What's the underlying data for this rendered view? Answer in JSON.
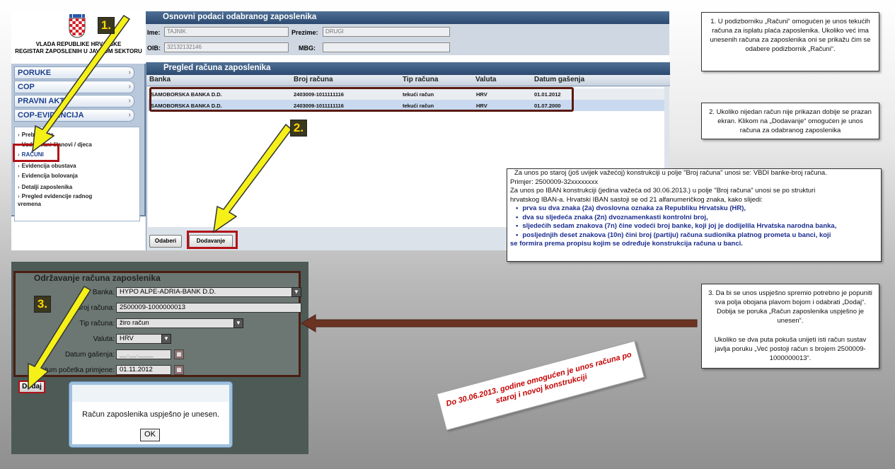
{
  "app": {
    "logo_line1": "VLADA REPUBLIKE HRVATSKE",
    "logo_line2": "REGISTAR ZAPOSLENIH U JAVNOM SEKTORU"
  },
  "sidebar": {
    "menu": [
      "PORUKE",
      "COP",
      "PRAVNI AKTI",
      "COP-EVIDENCIJA"
    ],
    "submenu": [
      "Prebivalište",
      "Uzdržavani članovi / djeca",
      "RAČUNI",
      "Evidencija obustava",
      "Evidencija bolovanja",
      "Detalji zaposlenika",
      "Pregled evidencije radnog vremena"
    ]
  },
  "employee_info": {
    "title": "Osnovni podaci odabranog zaposlenika",
    "ime_label": "Ime:",
    "ime_value": "TAJNIK",
    "prezime_label": "Prezime:",
    "prezime_value": "DRUGI",
    "oib_label": "OIB:",
    "oib_value": "32132132146",
    "mbg_label": "MBG:",
    "mbg_value": ""
  },
  "accounts": {
    "title": "Pregled računa zaposlenika",
    "columns": [
      "Banka",
      "Broj računa",
      "Tip računa",
      "Valuta",
      "Datum gašenja"
    ],
    "rows": [
      [
        "SAMOBORSKA BANKA D.D.",
        "2403009-1011111116",
        "tekući račun",
        "HRV",
        "01.01.2012"
      ],
      [
        "SAMOBORSKA BANKA D.D.",
        "2403009-1011111116",
        "tekući račun",
        "HRV",
        "01.07.2000"
      ]
    ],
    "btn_select": "Odaberi",
    "btn_add": "Dodavanje"
  },
  "maintenance": {
    "title": "Održavanje računa zaposlenika",
    "banka_label": "Banka:",
    "banka_value": "HYPO ALPE-ADRIA-BANK D.D.",
    "broj_label": "Broj računa:",
    "broj_value": "2500009-1000000013",
    "tip_label": "Tip računa:",
    "tip_value": "žiro račun",
    "valuta_label": "Valuta:",
    "valuta_value": "HRV",
    "gasenje_label": "Datum gašenja:",
    "gasenje_value": "__.__.____",
    "pocetak_label": "Datum početka primjene:",
    "pocetak_value": "01.11.2012",
    "btn_add": "Dodaj"
  },
  "dialog": {
    "message": "Račun zaposlenika uspješno je unesen.",
    "ok": "OK"
  },
  "badges": [
    "1.",
    "2.",
    "3."
  ],
  "notes": {
    "n1": "1. U podizborniku „Računi“ omogućen je unos tekućih računa za isplatu plaća zaposlenika. Ukoliko već ima unesenih računa za zaposlenika oni se prikažu čim se odabere podizbornik „Računi“.",
    "n2": "2.  Ukoliko nijedan račun nije prikazan dobije se prazan ekran. Klikom na „Dodavanje“ omogućen je unos računa za odabranog zaposlenika",
    "n3a": "3.  Da bi se unos uspješno spremio potrebno je popuniti sva polja obojana plavom bojom i odabrati „Dodaj“. Dobija se poruka „Račun zaposlenika uspješno je unesen“.",
    "n3b": "Ukoliko se dva puta pokuša unijeti isti račun sustav javlja poruku „Već postoji račun s brojem 2500009-1000000013“.",
    "n4_line1": "Za unos po staroj (još uvijek važećoj) konstrukciji u polje \"Broj računa\" unosi se: VBDI banke-broj računa.",
    "n4_line2": "Primjer: 2500009-32xxxxxxxx",
    "n4_line3": "Za unos po IBAN konstrukciji (jedina važeća od 30.06.2013.) u polje \"Broj računa\" unosi se po strukturi",
    "n4_line4": "hrvatskog IBAN-a. Hrvatski IBAN sastoji se od 21 alfanumeričkog znaka, kako slijedi:",
    "n4_b1": "prva su dva znaka (2a) dvoslovna oznaka za Republiku Hrvatsku (HR),",
    "n4_b2": "dva su sljedeća znaka (2n) dvoznamenkasti kontrolni broj,",
    "n4_b3": "sljedećih sedam znakova (7n) čine vodeći broj banke, koji joj je dodijelila Hrvatska narodna banka,",
    "n4_b4": "posljednjih deset znakova (10n) čini broj (partiju) računa sudionika platnog prometa u banci, koji",
    "n4_b5": "se formira prema propisu kojim se određuje konstrukcija računa u banci.",
    "stamp": "Do 30.06.2013. godine omogućen je unos računa po staroj i novoj konstrukciji"
  },
  "colors": {
    "highlight": "#b31217",
    "arrow": "#f5f018",
    "brown_arrow": "#6b3322",
    "header_blue": "#2c4a70"
  }
}
